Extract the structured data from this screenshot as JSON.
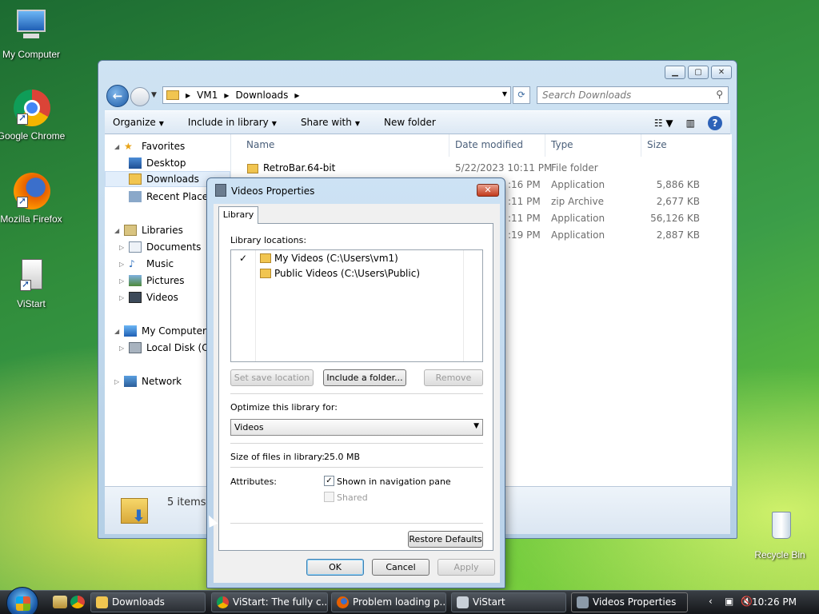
{
  "desktop": {
    "icons": [
      {
        "label": "My Computer"
      },
      {
        "label": "Google Chrome"
      },
      {
        "label": "Mozilla Firefox"
      },
      {
        "label": "ViStart"
      },
      {
        "label": "Recycle Bin"
      }
    ]
  },
  "explorer": {
    "breadcrumb": [
      "VM1",
      "Downloads"
    ],
    "search_placeholder": "Search Downloads",
    "toolbar": {
      "organize": "Organize",
      "include": "Include in library",
      "share": "Share with",
      "new_folder": "New folder"
    },
    "nav": {
      "favorites": "Favorites",
      "desktop": "Desktop",
      "downloads": "Downloads",
      "recent": "Recent Places",
      "libraries": "Libraries",
      "documents": "Documents",
      "music": "Music",
      "pictures": "Pictures",
      "videos": "Videos",
      "my_computer": "My Computer",
      "local_disk": "Local Disk (C:)",
      "network": "Network"
    },
    "columns": {
      "name": "Name",
      "date": "Date modified",
      "type": "Type",
      "size": "Size"
    },
    "files": [
      {
        "name": "RetroBar.64-bit",
        "date": "5/22/2023 10:11 PM",
        "type": "File folder",
        "size": ""
      },
      {
        "name": "",
        "date": ":16 PM",
        "type": "Application",
        "size": "5,886 KB"
      },
      {
        "name": "",
        "date": ":11 PM",
        "type": "zip Archive",
        "size": "2,677 KB"
      },
      {
        "name": "",
        "date": ":11 PM",
        "type": "Application",
        "size": "56,126 KB"
      },
      {
        "name": "",
        "date": ":19 PM",
        "type": "Application",
        "size": "2,887 KB"
      }
    ],
    "item_count": "5 items"
  },
  "dialog": {
    "title": "Videos Properties",
    "tab": "Library",
    "locations_label": "Library locations:",
    "locations": [
      {
        "check": "✓",
        "label": "My Videos (C:\\Users\\vm1)"
      },
      {
        "check": "",
        "label": "Public Videos (C:\\Users\\Public)"
      }
    ],
    "set_save": "Set save location",
    "include_folder": "Include a folder...",
    "remove": "Remove",
    "optimize_label": "Optimize this library for:",
    "optimize_value": "Videos",
    "size_label": "Size of files in library:",
    "size_value": "25.0 MB",
    "attributes_label": "Attributes:",
    "shown_nav": "Shown in navigation pane",
    "shared": "Shared",
    "restore": "Restore Defaults",
    "ok": "OK",
    "cancel": "Cancel",
    "apply": "Apply"
  },
  "taskbar": {
    "buttons": [
      {
        "label": "Downloads"
      },
      {
        "label": "ViStart: The fully c..."
      },
      {
        "label": "Problem loading p..."
      },
      {
        "label": "ViStart"
      },
      {
        "label": "Videos Properties"
      }
    ],
    "time": "10:26 PM"
  }
}
